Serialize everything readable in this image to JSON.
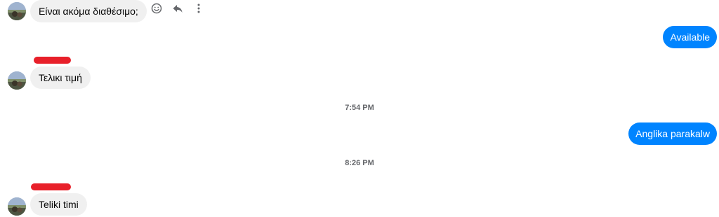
{
  "conversation": {
    "messages": [
      {
        "direction": "incoming",
        "text": "Είναι ακόμα διαθέσιμο;"
      },
      {
        "direction": "outgoing",
        "text": "Available"
      },
      {
        "direction": "incoming",
        "text": "Τελικι τιμή"
      },
      {
        "direction": "outgoing",
        "text": "Anglika parakalw"
      },
      {
        "direction": "incoming",
        "text": "Teliki timi"
      }
    ],
    "timestamps": [
      "7:54 PM",
      "8:26 PM"
    ]
  },
  "message_actions": {
    "icons": [
      "smiley-icon",
      "reply-icon",
      "more-vertical-icon"
    ]
  },
  "colors": {
    "outgoing_bubble": "#0084ff",
    "incoming_bubble": "#f0f0f0",
    "redaction": "#e8202a",
    "timestamp_text": "#65676b"
  }
}
